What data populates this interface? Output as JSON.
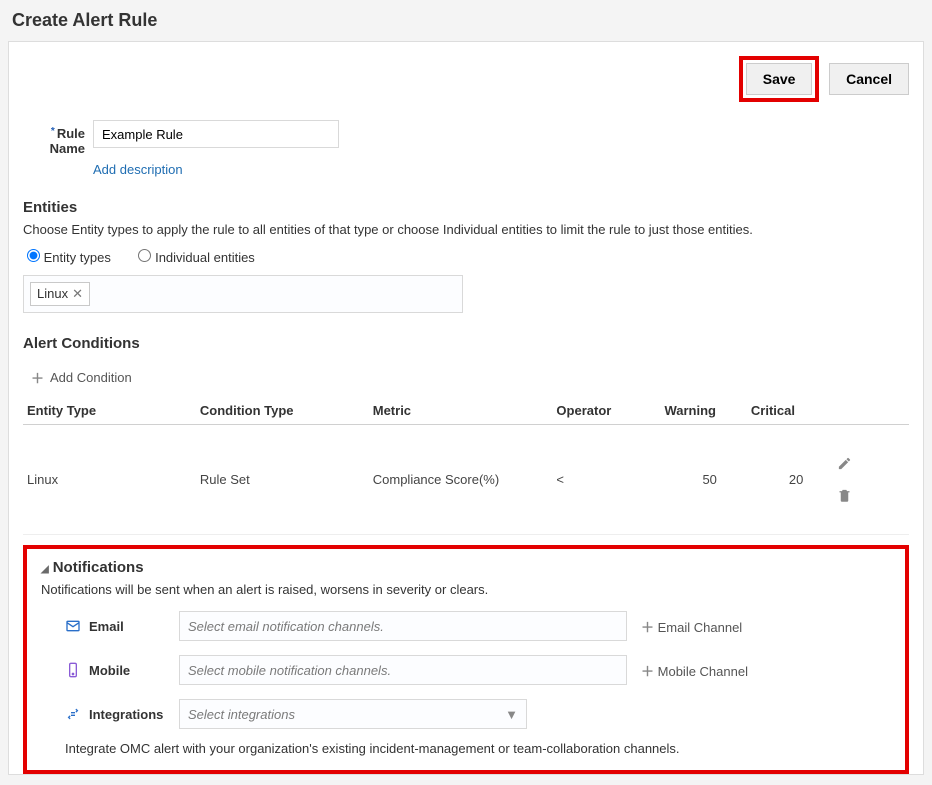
{
  "title": "Create Alert Rule",
  "actions": {
    "save": "Save",
    "cancel": "Cancel"
  },
  "form": {
    "rule_name_label": "Rule Name",
    "rule_name_value": "Example Rule",
    "add_description": "Add description"
  },
  "entities": {
    "heading": "Entities",
    "desc": "Choose Entity types to apply the rule to all entities of that type or choose Individual entities to limit the rule to just those entities.",
    "radio_types": "Entity types",
    "radio_individual": "Individual entities",
    "token": "Linux"
  },
  "conditions": {
    "heading": "Alert Conditions",
    "add": "Add Condition",
    "cols": {
      "entity_type": "Entity Type",
      "condition_type": "Condition Type",
      "metric": "Metric",
      "operator": "Operator",
      "warning": "Warning",
      "critical": "Critical"
    },
    "row": {
      "entity_type": "Linux",
      "condition_type": "Rule Set",
      "metric": "Compliance Score(%)",
      "operator": "<",
      "warning": "50",
      "critical": "20"
    }
  },
  "notifications": {
    "heading": "Notifications",
    "desc": "Notifications will be sent when an alert is raised, worsens in severity or clears.",
    "email_label": "Email",
    "email_placeholder": "Select email notification channels.",
    "email_add": "Email Channel",
    "mobile_label": "Mobile",
    "mobile_placeholder": "Select mobile notification channels.",
    "mobile_add": "Mobile Channel",
    "integrations_label": "Integrations",
    "integrations_placeholder": "Select integrations",
    "integrate_note": "Integrate OMC alert with your organization's existing incident-management or team-collaboration channels."
  }
}
